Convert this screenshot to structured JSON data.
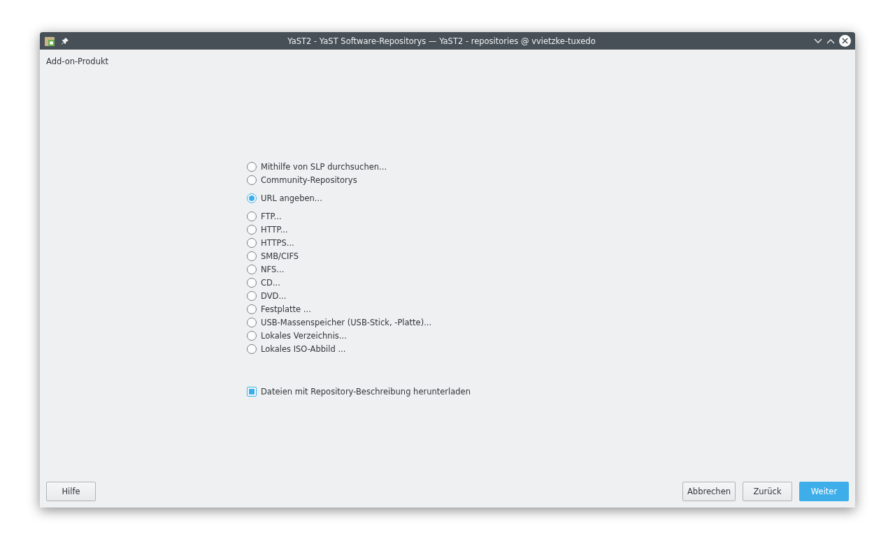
{
  "window": {
    "title": "YaST2 - YaST Software-Repositorys — YaST2 - repositories @ vvietzke-tuxedo"
  },
  "heading": "Add-on-Produkt",
  "option_groups": [
    {
      "options": [
        {
          "label": "Mithilfe von SLP durchsuchen...",
          "selected": false
        },
        {
          "label": "Community-Repositorys",
          "selected": false
        }
      ]
    },
    {
      "options": [
        {
          "label": "URL angeben...",
          "selected": true
        }
      ]
    },
    {
      "options": [
        {
          "label": "FTP...",
          "selected": false
        },
        {
          "label": "HTTP...",
          "selected": false
        },
        {
          "label": "HTTPS...",
          "selected": false
        },
        {
          "label": "SMB/CIFS",
          "selected": false
        },
        {
          "label": "NFS...",
          "selected": false
        },
        {
          "label": "CD...",
          "selected": false
        },
        {
          "label": "DVD...",
          "selected": false
        },
        {
          "label": "Festplatte ...",
          "selected": false
        },
        {
          "label": "USB-Massenspeicher (USB-Stick, -Platte)...",
          "selected": false
        },
        {
          "label": "Lokales Verzeichnis...",
          "selected": false
        },
        {
          "label": "Lokales ISO-Abbild ...",
          "selected": false
        }
      ]
    }
  ],
  "download_checkbox": {
    "label": "Dateien mit Repository-Beschreibung herunterladen",
    "checked": true
  },
  "buttons_left": [
    {
      "label": "Hilfe",
      "kind": "normal"
    }
  ],
  "buttons_right": [
    {
      "label": "Abbrechen",
      "kind": "normal"
    },
    {
      "label": "Zurück",
      "kind": "normal"
    },
    {
      "label": "Weiter",
      "kind": "primary"
    }
  ]
}
